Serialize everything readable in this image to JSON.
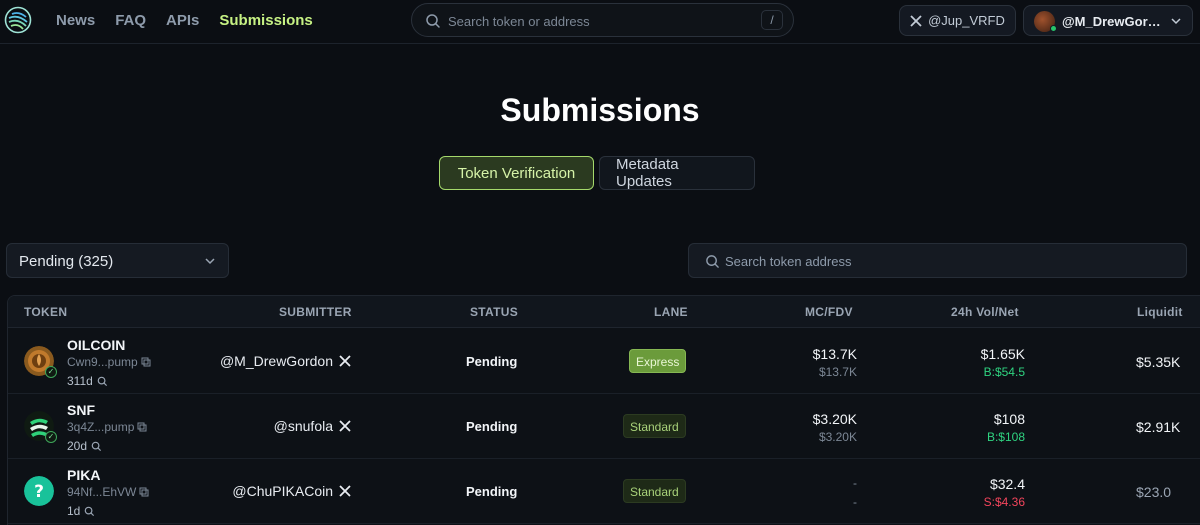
{
  "nav": {
    "items": [
      {
        "label": "News",
        "active": false
      },
      {
        "label": "FAQ",
        "active": false
      },
      {
        "label": "APIs",
        "active": false
      },
      {
        "label": "Submissions",
        "active": true
      }
    ]
  },
  "search": {
    "placeholder": "Search token or address",
    "shortcut": "/"
  },
  "x_account": {
    "label": "@Jup_VRFD",
    "icon": "x-logo-icon"
  },
  "user": {
    "name": "@M_DrewGord...",
    "icon": "chevron-down-icon",
    "online_color": "#27c46b"
  },
  "page": {
    "title": "Submissions"
  },
  "tabs": [
    {
      "label": "Token Verification",
      "active": true
    },
    {
      "label": "Metadata Updates",
      "active": false
    }
  ],
  "filter": {
    "status_label": "Pending (325)"
  },
  "address_search": {
    "placeholder": "Search token address"
  },
  "table": {
    "headers": {
      "token": "TOKEN",
      "submitter": "SUBMITTER",
      "status": "STATUS",
      "lane": "LANE",
      "mc": "MC/FDV",
      "vol": "24h Vol/Net",
      "liq": "Liquidit"
    },
    "rows": [
      {
        "symbol": "OILCOIN",
        "address": "Cwn9...pump",
        "age": "311d",
        "submitter": "@M_DrewGordon",
        "status": "Pending",
        "lane": "Express",
        "mc": "$13.7K",
        "fdv": "$13.7K",
        "vol": "$1.65K",
        "net": "B:$54.5",
        "net_color": "#2fd380",
        "liq": "$5.35K",
        "icon": "oilcoin-token-icon"
      },
      {
        "symbol": "SNF",
        "address": "3q4Z...pump",
        "age": "20d",
        "submitter": "@snufola",
        "status": "Pending",
        "lane": "Standard",
        "mc": "$3.20K",
        "fdv": "$3.20K",
        "vol": "$108",
        "net": "B:$108",
        "net_color": "#2fd380",
        "liq": "$2.91K",
        "icon": "snf-token-icon"
      },
      {
        "symbol": "PIKA",
        "address": "94Nf...EhVW",
        "age": "1d",
        "submitter": "@ChuPIKACoin",
        "status": "Pending",
        "lane": "Standard",
        "mc": "-",
        "fdv": "-",
        "vol": "$32.4",
        "net": "S:$4.36",
        "net_color": "#f2455c",
        "liq": "$23.0",
        "icon": "question-mark-icon"
      }
    ]
  },
  "colors": {
    "accent": "#c7f284",
    "background": "#0b0e13",
    "buy": "#2fd380",
    "sell": "#f2455c"
  }
}
